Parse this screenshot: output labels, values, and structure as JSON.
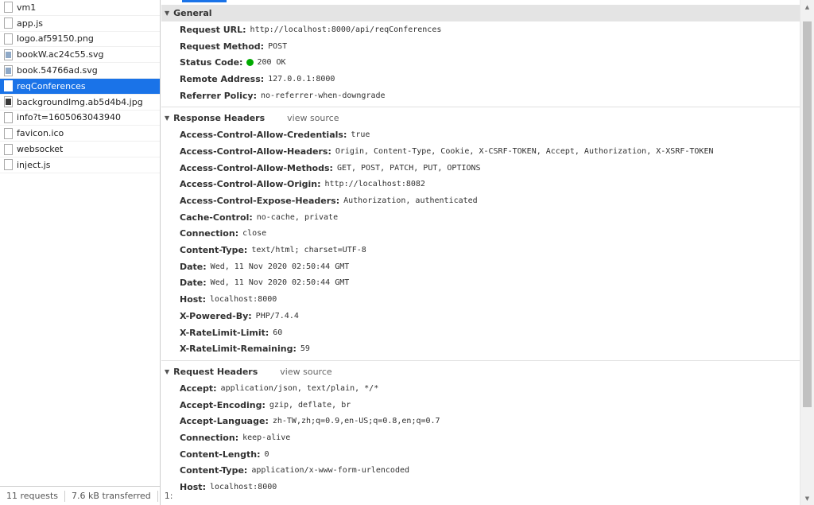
{
  "requests": [
    {
      "name": "vm1",
      "icon": "document"
    },
    {
      "name": "app.js",
      "icon": "document"
    },
    {
      "name": "logo.af59150.png",
      "icon": "document"
    },
    {
      "name": "bookW.ac24c55.svg",
      "icon": "image"
    },
    {
      "name": "book.54766ad.svg",
      "icon": "image"
    },
    {
      "name": "reqConferences",
      "icon": "document"
    },
    {
      "name": "backgroundImg.ab5d4b4.jpg",
      "icon": "image-dark"
    },
    {
      "name": "info?t=1605063043940",
      "icon": "document"
    },
    {
      "name": "favicon.ico",
      "icon": "document"
    },
    {
      "name": "websocket",
      "icon": "document"
    },
    {
      "name": "inject.js",
      "icon": "document"
    }
  ],
  "status_bar": {
    "requests": "11 requests",
    "transferred": "7.6 kB transferred",
    "truncated": "1:"
  },
  "general": {
    "title": "General",
    "rows": [
      {
        "key": "Request URL:",
        "value": "http://localhost:8000/api/reqConferences"
      },
      {
        "key": "Request Method:",
        "value": "POST"
      },
      {
        "key": "Status Code:",
        "value": "200 OK"
      },
      {
        "key": "Remote Address:",
        "value": "127.0.0.1:8000"
      },
      {
        "key": "Referrer Policy:",
        "value": "no-referrer-when-downgrade"
      }
    ]
  },
  "response_headers": {
    "title": "Response Headers",
    "view_source": "view source",
    "rows": [
      {
        "key": "Access-Control-Allow-Credentials:",
        "value": "true"
      },
      {
        "key": "Access-Control-Allow-Headers:",
        "value": "Origin, Content-Type, Cookie, X-CSRF-TOKEN, Accept, Authorization, X-XSRF-TOKEN"
      },
      {
        "key": "Access-Control-Allow-Methods:",
        "value": "GET, POST, PATCH, PUT, OPTIONS"
      },
      {
        "key": "Access-Control-Allow-Origin:",
        "value": "http://localhost:8082"
      },
      {
        "key": "Access-Control-Expose-Headers:",
        "value": "Authorization, authenticated"
      },
      {
        "key": "Cache-Control:",
        "value": "no-cache, private"
      },
      {
        "key": "Connection:",
        "value": "close"
      },
      {
        "key": "Content-Type:",
        "value": "text/html; charset=UTF-8"
      },
      {
        "key": "Date:",
        "value": "Wed, 11 Nov 2020 02:50:44 GMT"
      },
      {
        "key": "Date:",
        "value": "Wed, 11 Nov 2020 02:50:44 GMT"
      },
      {
        "key": "Host:",
        "value": "localhost:8000"
      },
      {
        "key": "X-Powered-By:",
        "value": "PHP/7.4.4"
      },
      {
        "key": "X-RateLimit-Limit:",
        "value": "60"
      },
      {
        "key": "X-RateLimit-Remaining:",
        "value": "59"
      }
    ]
  },
  "request_headers": {
    "title": "Request Headers",
    "view_source": "view source",
    "rows": [
      {
        "key": "Accept:",
        "value": "application/json, text/plain, */*"
      },
      {
        "key": "Accept-Encoding:",
        "value": "gzip, deflate, br"
      },
      {
        "key": "Accept-Language:",
        "value": "zh-TW,zh;q=0.9,en-US;q=0.8,en;q=0.7"
      },
      {
        "key": "Connection:",
        "value": "keep-alive"
      },
      {
        "key": "Content-Length:",
        "value": "0"
      },
      {
        "key": "Content-Type:",
        "value": "application/x-www-form-urlencoded"
      },
      {
        "key": "Host:",
        "value": "localhost:8000"
      }
    ]
  },
  "colors": {
    "selected": "#1a73e8",
    "status_ok": "#00aa00"
  }
}
